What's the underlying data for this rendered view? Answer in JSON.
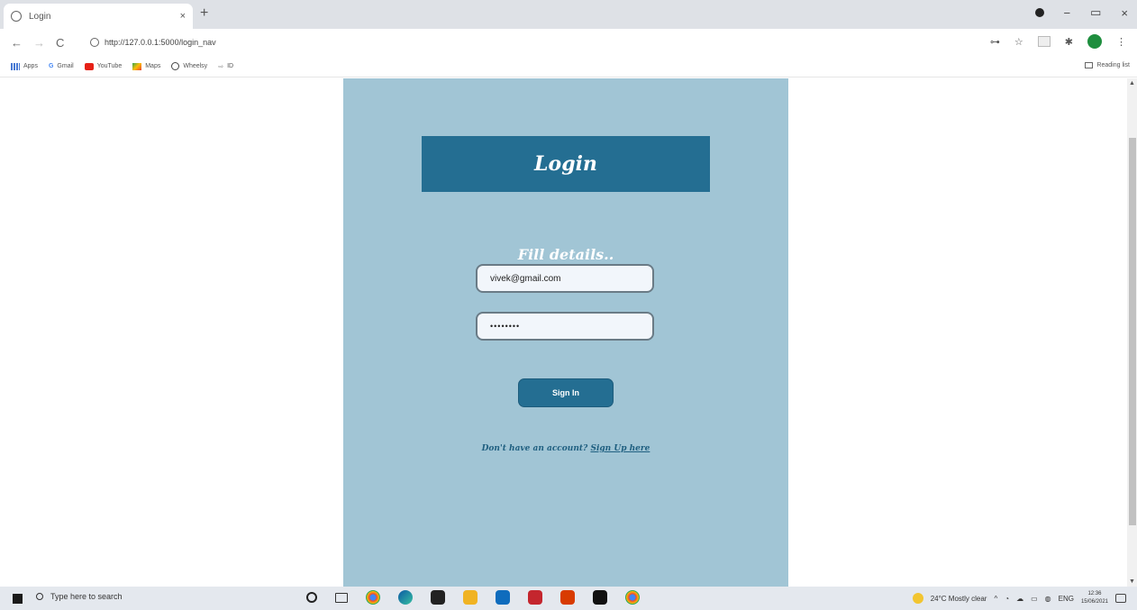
{
  "browser": {
    "tab_title": "Login",
    "tab_close": "×",
    "new_tab": "+",
    "address": "http://127.0.0.1:5000/login_nav",
    "nav": {
      "back": "←",
      "forward": "→",
      "reload": "C"
    },
    "window": {
      "minimize": "−",
      "restore": "▭",
      "close": "×"
    }
  },
  "bookmarks": {
    "items": [
      "Apps",
      "Gmail",
      "YouTube",
      "Maps",
      "Wheelsy",
      "ID"
    ],
    "reading_list": "Reading list"
  },
  "login": {
    "title": "Login",
    "subtitle": "Fill details..",
    "email_value": "vivek@gmail.com",
    "password_value": "••••••••",
    "signin_label": "Sign In",
    "signup_prompt": "Don't have an account?",
    "signup_link": "Sign Up here"
  },
  "taskbar": {
    "search_placeholder": "Type here to search",
    "weather": "24°C  Mostly clear",
    "language": "ENG",
    "time": "12:36",
    "date": "15/06/2021"
  },
  "colors": {
    "panel": "#a1c5d5",
    "accent": "#246e92"
  }
}
